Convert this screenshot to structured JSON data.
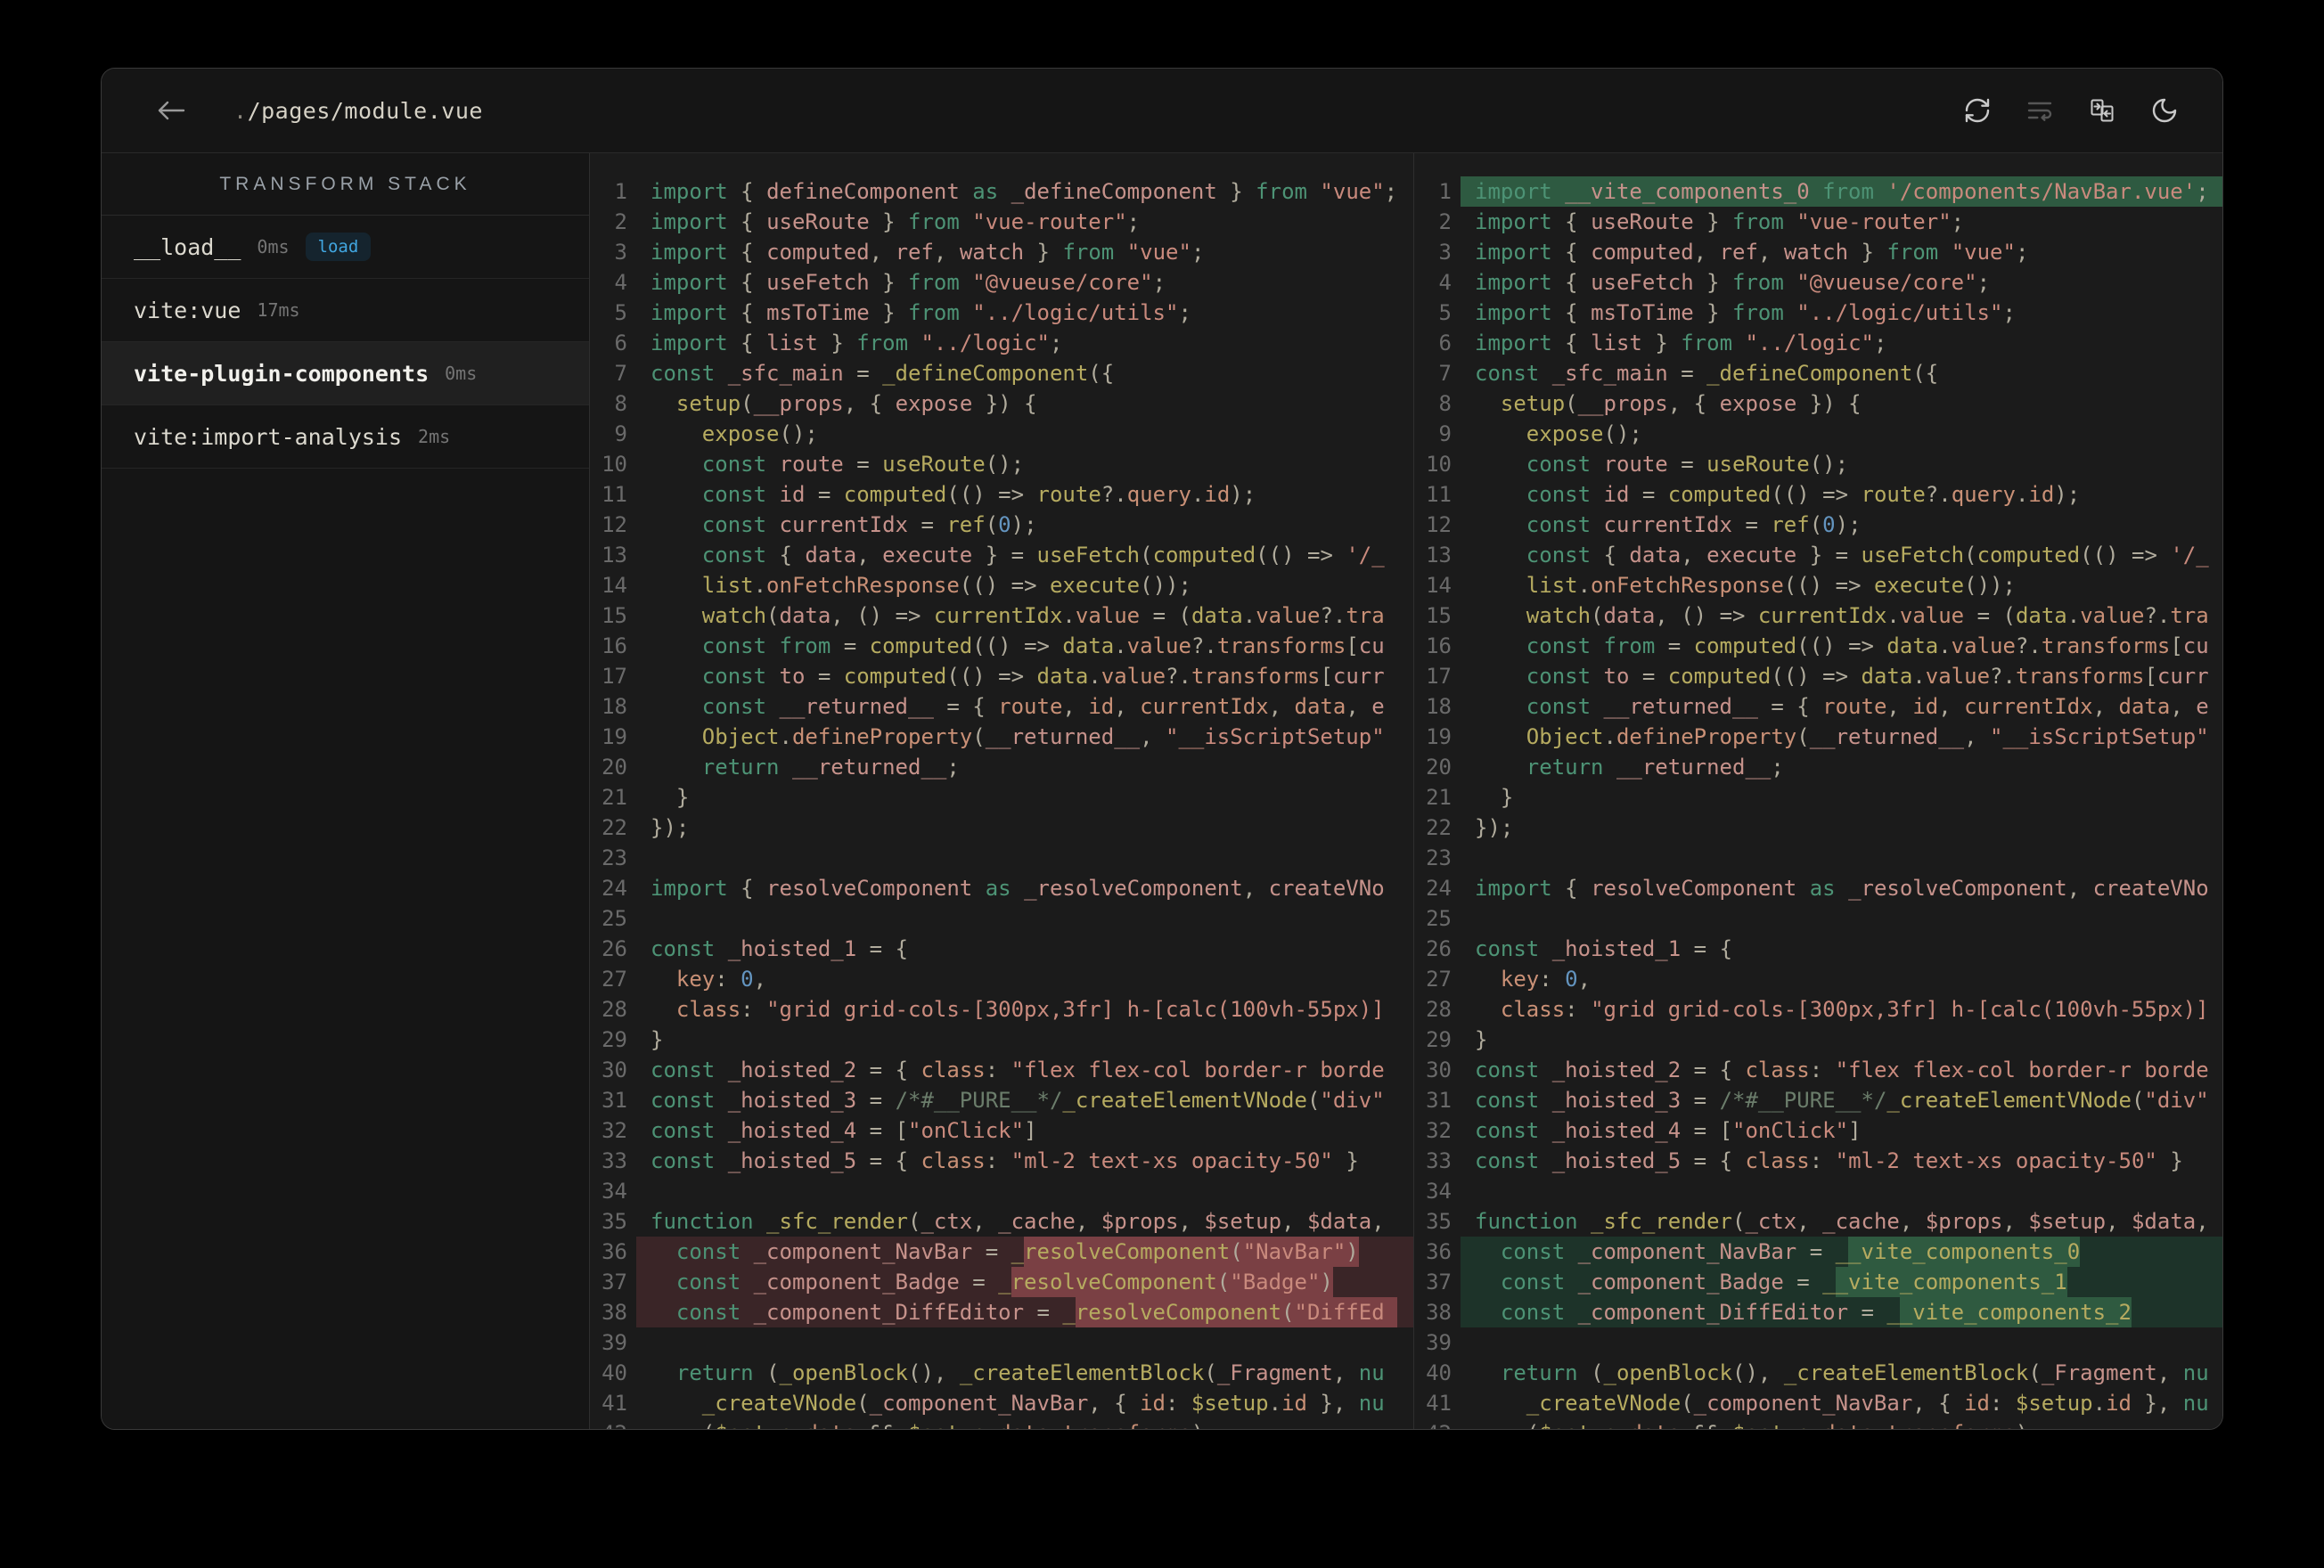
{
  "colors": {
    "page_bg": "#000000",
    "window_bg": "#151515",
    "editor_bg": "#1b1b1b",
    "accent_blue": "#41a6e0",
    "diff_del_line": "#3a2527",
    "diff_del_word": "#7a4044",
    "diff_add_line": "#1d3329",
    "diff_add_word": "#2f5a40",
    "syntax": {
      "keyword": "#4d9375",
      "string": "#c98a7d",
      "number": "#6394bf",
      "function": "#b6ab60",
      "property": "#c99076",
      "variable": "#c6928b",
      "punctuation": "#b0ab9c",
      "comment": "#6b7d6b"
    }
  },
  "titlebar": {
    "back_icon": "arrow-left-icon",
    "title_dot": ".",
    "title_path": "/pages/module.vue",
    "title_full": "./pages/module.vue",
    "icons": [
      {
        "name": "refresh-icon",
        "disabled": false
      },
      {
        "name": "wrap-lines-icon",
        "disabled": true
      },
      {
        "name": "compare-panes-icon",
        "disabled": false
      },
      {
        "name": "moon-icon",
        "disabled": false
      }
    ]
  },
  "sidebar": {
    "header": "TRANSFORM STACK",
    "items": [
      {
        "label": "__load__",
        "time": "0ms",
        "badge": "load",
        "selected": false
      },
      {
        "label": "vite:vue",
        "time": "17ms",
        "badge": null,
        "selected": false
      },
      {
        "label": "vite-plugin-components",
        "time": "0ms",
        "badge": null,
        "selected": true
      },
      {
        "label": "vite:import-analysis",
        "time": "2ms",
        "badge": null,
        "selected": false
      }
    ]
  },
  "editor": {
    "before_lines": [
      {
        "t": "import { defineComponent as _defineComponent } from \"vue\";"
      },
      {
        "t": "import { useRoute } from \"vue-router\";"
      },
      {
        "t": "import { computed, ref, watch } from \"vue\";"
      },
      {
        "t": "import { useFetch } from \"@vueuse/core\";"
      },
      {
        "t": "import { msToTime } from \"../logic/utils\";"
      },
      {
        "t": "import { list } from \"../logic\";"
      },
      {
        "t": "const _sfc_main = _defineComponent({"
      },
      {
        "t": "  setup(__props, { expose }) {"
      },
      {
        "t": "    expose();"
      },
      {
        "t": "    const route = useRoute();"
      },
      {
        "t": "    const id = computed(() => route?.query.id);"
      },
      {
        "t": "    const currentIdx = ref(0);"
      },
      {
        "t": "    const { data, execute } = useFetch(computed(() => '/_"
      },
      {
        "t": "    list.onFetchResponse(() => execute());"
      },
      {
        "t": "    watch(data, () => currentIdx.value = (data.value?.tra"
      },
      {
        "t": "    const from = computed(() => data.value?.transforms[cu"
      },
      {
        "t": "    const to = computed(() => data.value?.transforms[curr"
      },
      {
        "t": "    const __returned__ = { route, id, currentIdx, data, e"
      },
      {
        "t": "    Object.defineProperty(__returned__, \"__isScriptSetup\""
      },
      {
        "t": "    return __returned__;"
      },
      {
        "t": "  }"
      },
      {
        "t": "});"
      },
      {
        "t": ""
      },
      {
        "t": "import { resolveComponent as _resolveComponent, createVNo"
      },
      {
        "t": ""
      },
      {
        "t": "const _hoisted_1 = {"
      },
      {
        "t": "  key: 0,"
      },
      {
        "t": "  class: \"grid grid-cols-[300px,3fr] h-[calc(100vh-55px)]"
      },
      {
        "t": "}"
      },
      {
        "t": "const _hoisted_2 = { class: \"flex flex-col border-r borde"
      },
      {
        "t": "const _hoisted_3 = /*#__PURE__*/_createElementVNode(\"div\""
      },
      {
        "t": "const _hoisted_4 = [\"onClick\"]"
      },
      {
        "t": "const _hoisted_5 = { class: \"ml-2 text-xs opacity-50\" }"
      },
      {
        "t": ""
      },
      {
        "t": "function _sfc_render(_ctx, _cache, $props, $setup, $data,"
      },
      {
        "t": "  const _component_NavBar = _resolveComponent(\"NavBar\")",
        "hl": "del",
        "mk": [
          29,
          55
        ]
      },
      {
        "t": "  const _component_Badge = _resolveComponent(\"Badge\")",
        "hl": "del",
        "mk": [
          28,
          53
        ]
      },
      {
        "t": "  const _component_DiffEditor = _resolveComponent(\"DiffEd",
        "hl": "del",
        "mk": [
          33,
          58
        ]
      },
      {
        "t": ""
      },
      {
        "t": "  return (_openBlock(), _createElementBlock(_Fragment, nu"
      },
      {
        "t": "    _createVNode(_component_NavBar, { id: $setup.id }, nu"
      },
      {
        "t": "    ($setup.data && $setup.data.transforms)"
      }
    ],
    "after_lines": [
      {
        "t": "import __vite_components_0 from '/components/NavBar.vue';",
        "hl": "addw"
      },
      {
        "t": "import { useRoute } from \"vue-router\";"
      },
      {
        "t": "import { computed, ref, watch } from \"vue\";"
      },
      {
        "t": "import { useFetch } from \"@vueuse/core\";"
      },
      {
        "t": "import { msToTime } from \"../logic/utils\";"
      },
      {
        "t": "import { list } from \"../logic\";"
      },
      {
        "t": "const _sfc_main = _defineComponent({"
      },
      {
        "t": "  setup(__props, { expose }) {"
      },
      {
        "t": "    expose();"
      },
      {
        "t": "    const route = useRoute();"
      },
      {
        "t": "    const id = computed(() => route?.query.id);"
      },
      {
        "t": "    const currentIdx = ref(0);"
      },
      {
        "t": "    const { data, execute } = useFetch(computed(() => '/_"
      },
      {
        "t": "    list.onFetchResponse(() => execute());"
      },
      {
        "t": "    watch(data, () => currentIdx.value = (data.value?.tra"
      },
      {
        "t": "    const from = computed(() => data.value?.transforms[cu"
      },
      {
        "t": "    const to = computed(() => data.value?.transforms[curr"
      },
      {
        "t": "    const __returned__ = { route, id, currentIdx, data, e"
      },
      {
        "t": "    Object.defineProperty(__returned__, \"__isScriptSetup\""
      },
      {
        "t": "    return __returned__;"
      },
      {
        "t": "  }"
      },
      {
        "t": "});"
      },
      {
        "t": ""
      },
      {
        "t": "import { resolveComponent as _resolveComponent, createVNo"
      },
      {
        "t": ""
      },
      {
        "t": "const _hoisted_1 = {"
      },
      {
        "t": "  key: 0,"
      },
      {
        "t": "  class: \"grid grid-cols-[300px,3fr] h-[calc(100vh-55px)]"
      },
      {
        "t": "}"
      },
      {
        "t": "const _hoisted_2 = { class: \"flex flex-col border-r borde"
      },
      {
        "t": "const _hoisted_3 = /*#__PURE__*/_createElementVNode(\"div\""
      },
      {
        "t": "const _hoisted_4 = [\"onClick\"]"
      },
      {
        "t": "const _hoisted_5 = { class: \"ml-2 text-xs opacity-50\" }"
      },
      {
        "t": ""
      },
      {
        "t": "function _sfc_render(_ctx, _cache, $props, $setup, $data,"
      },
      {
        "t": "  const _component_NavBar = __vite_components_0",
        "hl": "add",
        "mk": [
          29,
          47
        ]
      },
      {
        "t": "  const _component_Badge = __vite_components_1",
        "hl": "add",
        "mk": [
          28,
          46
        ]
      },
      {
        "t": "  const _component_DiffEditor = __vite_components_2",
        "hl": "add",
        "mk": [
          33,
          51
        ]
      },
      {
        "t": ""
      },
      {
        "t": "  return (_openBlock(), _createElementBlock(_Fragment, nu"
      },
      {
        "t": "    _createVNode(_component_NavBar, { id: $setup.id }, nu"
      },
      {
        "t": "    ($setup.data && $setup.data.transforms)"
      }
    ]
  }
}
